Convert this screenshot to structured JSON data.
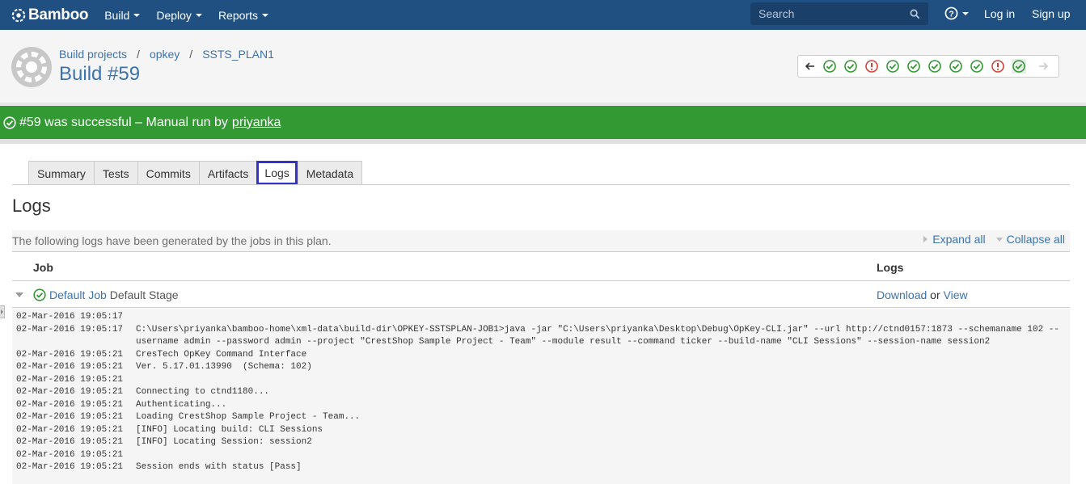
{
  "topnav": {
    "logo": "Bamboo",
    "items": [
      {
        "label": "Build"
      },
      {
        "label": "Deploy"
      },
      {
        "label": "Reports"
      }
    ],
    "search_placeholder": "Search",
    "login": "Log in",
    "signup": "Sign up"
  },
  "header": {
    "breadcrumb": [
      "Build projects",
      "opkey",
      "SSTS_PLAN1"
    ],
    "title": "Build #59",
    "history": [
      "success",
      "success",
      "failed",
      "success",
      "success",
      "success",
      "success",
      "success",
      "failed",
      "success"
    ]
  },
  "banner": {
    "text": "#59 was successful – Manual run by",
    "user": "priyanka",
    "color": "#339933"
  },
  "tabs": [
    "Summary",
    "Tests",
    "Commits",
    "Artifacts",
    "Logs",
    "Metadata"
  ],
  "logs": {
    "heading": "Logs",
    "info": "The following logs have been generated by the jobs in this plan.",
    "expand_all": "Expand all",
    "collapse_all": "Collapse all",
    "col_job": "Job",
    "col_logs": "Logs",
    "job": {
      "name": "Default Job",
      "stage": "Default Stage",
      "download": "Download",
      "or": "or",
      "view": "View"
    },
    "lines": [
      {
        "ts": "02-Mar-2016 19:05:17",
        "msg": ""
      },
      {
        "ts": "02-Mar-2016 19:05:17",
        "msg": "C:\\Users\\priyanka\\bamboo-home\\xml-data\\build-dir\\OPKEY-SSTSPLAN-JOB1>java -jar \"C:\\Users\\priyanka\\Desktop\\Debug\\OpKey-CLI.jar\" --url http://ctnd0157:1873 --schemaname 102 --username admin --password admin --project \"CrestShop Sample Project - Team\" --module result --command ticker --build-name \"CLI Sessions\" --session-name session2"
      },
      {
        "ts": "02-Mar-2016 19:05:21",
        "msg": "CresTech OpKey Command Interface"
      },
      {
        "ts": "02-Mar-2016 19:05:21",
        "msg": "Ver. 5.17.01.13990  (Schema: 102)"
      },
      {
        "ts": "02-Mar-2016 19:05:21",
        "msg": ""
      },
      {
        "ts": "02-Mar-2016 19:05:21",
        "msg": "Connecting to ctnd1180..."
      },
      {
        "ts": "02-Mar-2016 19:05:21",
        "msg": "Authenticating..."
      },
      {
        "ts": "02-Mar-2016 19:05:21",
        "msg": "Loading CrestShop Sample Project - Team..."
      },
      {
        "ts": "02-Mar-2016 19:05:21",
        "msg": "[INFO] Locating build: CLI Sessions"
      },
      {
        "ts": "02-Mar-2016 19:05:21",
        "msg": "[INFO] Locating Session: session2"
      },
      {
        "ts": "02-Mar-2016 19:05:21",
        "msg": ""
      },
      {
        "ts": "02-Mar-2016 19:05:21",
        "msg": "Session ends with status [Pass]"
      }
    ]
  }
}
